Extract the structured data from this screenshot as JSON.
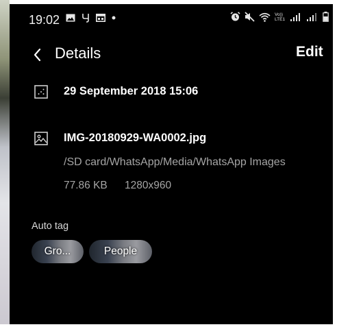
{
  "status_bar": {
    "time": "19:02",
    "icons_left": [
      "image-notification-icon",
      "y-app-notification-icon",
      "calendar-notification-icon",
      "dot-icon"
    ],
    "icons_right": [
      "alarm-icon",
      "mute-icon",
      "wifi-icon",
      "volte-icon",
      "signal-icon",
      "signal-icon",
      "battery-icon"
    ],
    "volte_label": "Vo)) LTE1"
  },
  "app_bar": {
    "title": "Details",
    "edit_label": "Edit"
  },
  "details": {
    "date": "29 September 2018 15:06",
    "file_name": "IMG-20180929-WA0002.jpg",
    "path": "/SD card/WhatsApp/Media/WhatsApp Images",
    "size": "77.86 KB",
    "resolution": "1280x960"
  },
  "auto_tag": {
    "label": "Auto tag",
    "chips": [
      "Gro...",
      "People"
    ]
  },
  "colors": {
    "background": "#000000",
    "primary_text": "#ffffff",
    "secondary_text": "#a5a5a5"
  }
}
